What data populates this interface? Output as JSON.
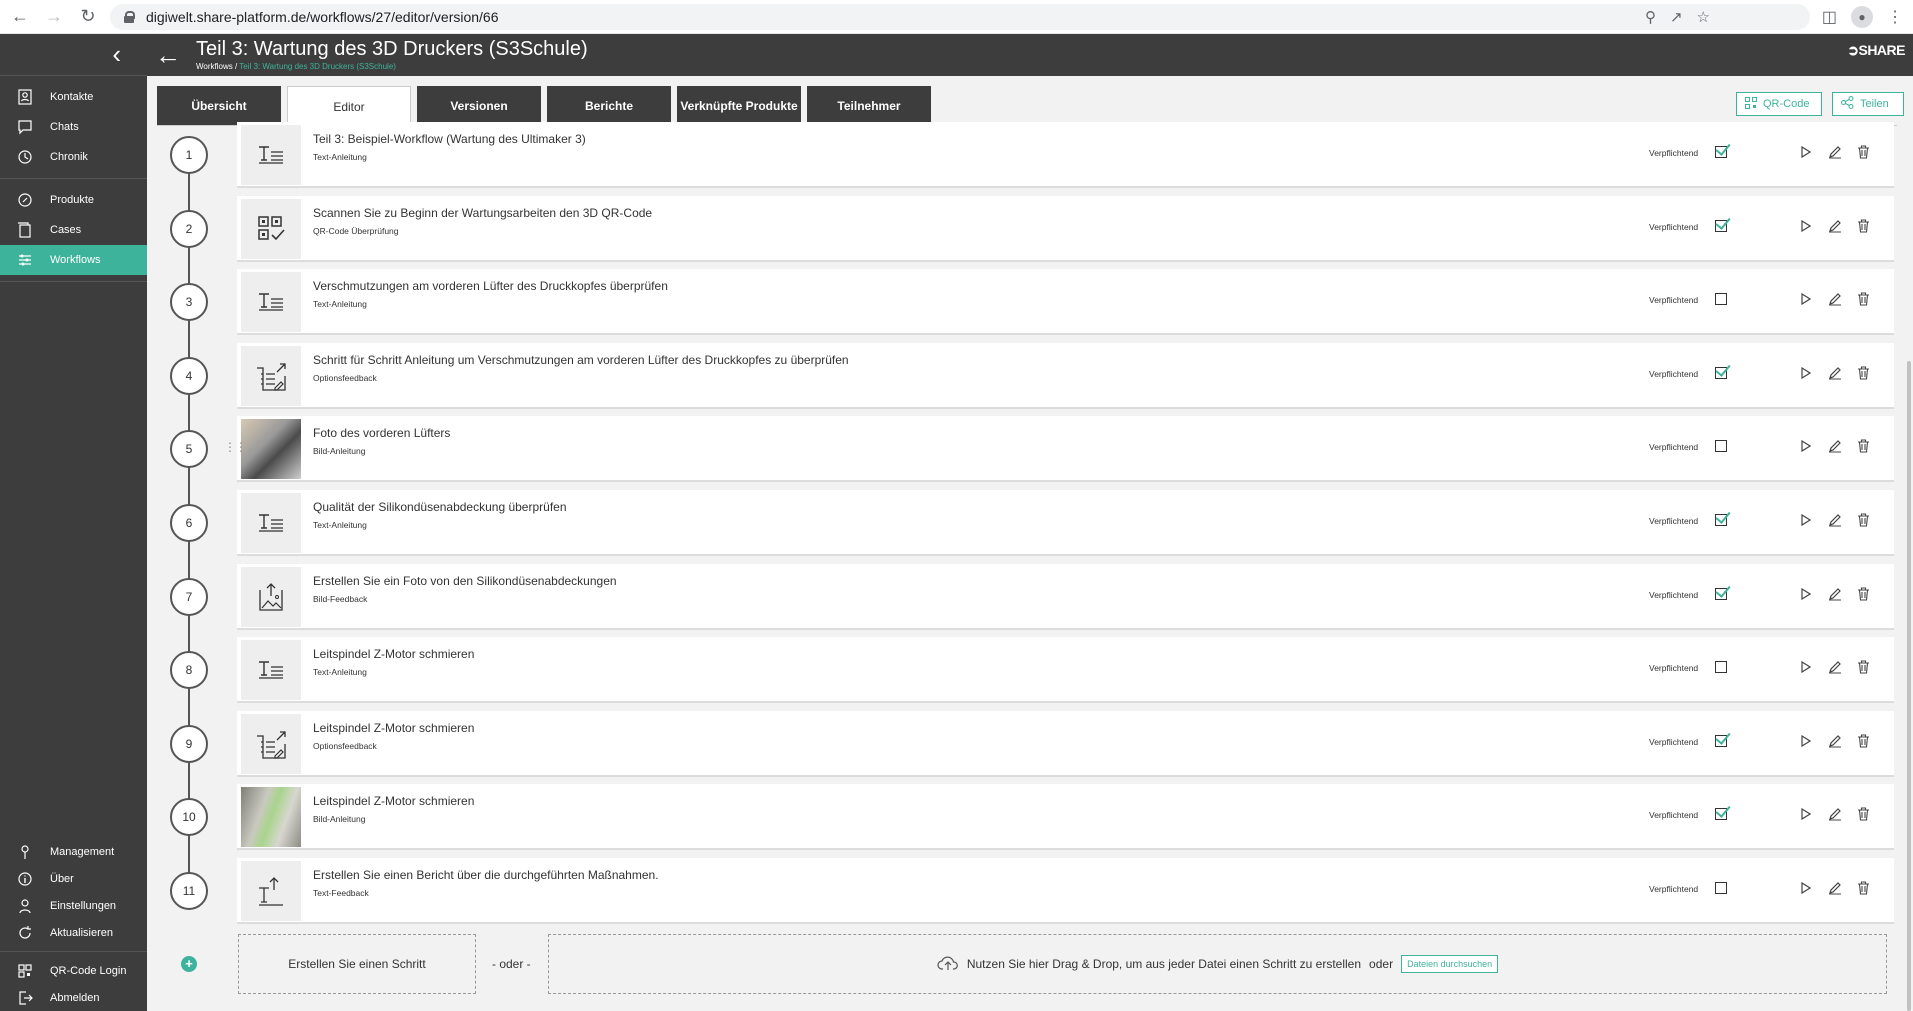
{
  "browser": {
    "url": "digiwelt.share-platform.de/workflows/27/editor/version/66"
  },
  "sidebar": {
    "top_items": [
      {
        "label": "Kontakte",
        "icon": "contact-icon"
      },
      {
        "label": "Chats",
        "icon": "chat-icon"
      },
      {
        "label": "Chronik",
        "icon": "history-icon"
      }
    ],
    "mid_items": [
      {
        "label": "Produkte",
        "icon": "product-icon"
      },
      {
        "label": "Cases",
        "icon": "cases-icon"
      },
      {
        "label": "Workflows",
        "icon": "workflow-icon",
        "active": true
      }
    ],
    "bottom_items": [
      {
        "label": "Management",
        "icon": "management-icon"
      },
      {
        "label": "Über",
        "icon": "info-icon"
      },
      {
        "label": "Einstellungen",
        "icon": "settings-icon"
      },
      {
        "label": "Aktualisieren",
        "icon": "refresh-icon"
      }
    ],
    "footer_items": [
      {
        "label": "QR-Code Login",
        "icon": "qr-login-icon"
      },
      {
        "label": "Abmelden",
        "icon": "logout-icon"
      }
    ]
  },
  "header": {
    "title": "Teil 3: Wartung des 3D Druckers (S3Schule)",
    "breadcrumb_root": "Workflows / ",
    "breadcrumb_current": "Teil 3: Wartung des 3D Druckers (S3Schule)",
    "logo": "SHARE"
  },
  "tabs": [
    {
      "label": "Übersicht",
      "active": false
    },
    {
      "label": "Editor",
      "active": true
    },
    {
      "label": "Versionen",
      "active": false
    },
    {
      "label": "Berichte",
      "active": false
    },
    {
      "label": "Verknüpfte Produkte",
      "active": false
    },
    {
      "label": "Teilnehmer",
      "active": false
    }
  ],
  "actions": {
    "qr_label": "QR-Code",
    "share_label": "Teilen"
  },
  "mandatory_label": "Verpflichtend",
  "steps": [
    {
      "num": "1",
      "title": "Teil 3: Beispiel-Workflow (Wartung des Ultimaker 3)",
      "type": "Text-Anleitung",
      "icon": "text-instruction-icon",
      "mandatory": true
    },
    {
      "num": "2",
      "title": "Scannen Sie zu Beginn der Wartungsarbeiten den 3D QR-Code",
      "type": "QR-Code Überprüfung",
      "icon": "qr-check-icon",
      "mandatory": true
    },
    {
      "num": "3",
      "title": "Verschmutzungen am vorderen Lüfter des Druckkopfes überprüfen",
      "type": "Text-Anleitung",
      "icon": "text-instruction-icon",
      "mandatory": false
    },
    {
      "num": "4",
      "title": "Schritt für Schritt Anleitung um Verschmutzungen am vorderen Lüfter des Druckkopfes zu überprüfen",
      "type": "Optionsfeedback",
      "icon": "option-feedback-icon",
      "mandatory": true
    },
    {
      "num": "5",
      "title": "Foto des vorderen Lüfters",
      "type": "Bild-Anleitung",
      "icon": "photo-thumbnail",
      "mandatory": false
    },
    {
      "num": "6",
      "title": "Qualität der Silikondüsenabdeckung überprüfen",
      "type": "Text-Anleitung",
      "icon": "text-instruction-icon",
      "mandatory": true
    },
    {
      "num": "7",
      "title": "Erstellen Sie ein Foto von den Silikondüsenabdeckungen",
      "type": "Bild-Feedback",
      "icon": "image-feedback-icon",
      "mandatory": true
    },
    {
      "num": "8",
      "title": "Leitspindel Z-Motor schmieren",
      "type": "Text-Anleitung",
      "icon": "text-instruction-icon",
      "mandatory": false
    },
    {
      "num": "9",
      "title": "Leitspindel Z-Motor schmieren",
      "type": "Optionsfeedback",
      "icon": "option-feedback-icon",
      "mandatory": true
    },
    {
      "num": "10",
      "title": "Leitspindel Z-Motor schmieren",
      "type": "Bild-Anleitung",
      "icon": "photo-thumbnail",
      "mandatory": true
    },
    {
      "num": "11",
      "title": "Erstellen Sie einen Bericht über die durchgeführten Maßnahmen.",
      "type": "Text-Feedback",
      "icon": "text-feedback-icon",
      "mandatory": false
    }
  ],
  "bottom": {
    "create_label": "Erstellen Sie einen Schritt",
    "oder": "- oder -",
    "drop_text": "Nutzen Sie hier Drag & Drop, um aus jeder Datei einen Schritt zu erstellen",
    "oder2": "oder",
    "browse_label": "Dateien durchsuchen"
  },
  "colors": {
    "accent": "#3eb39b",
    "dark": "#3d3d3d"
  }
}
